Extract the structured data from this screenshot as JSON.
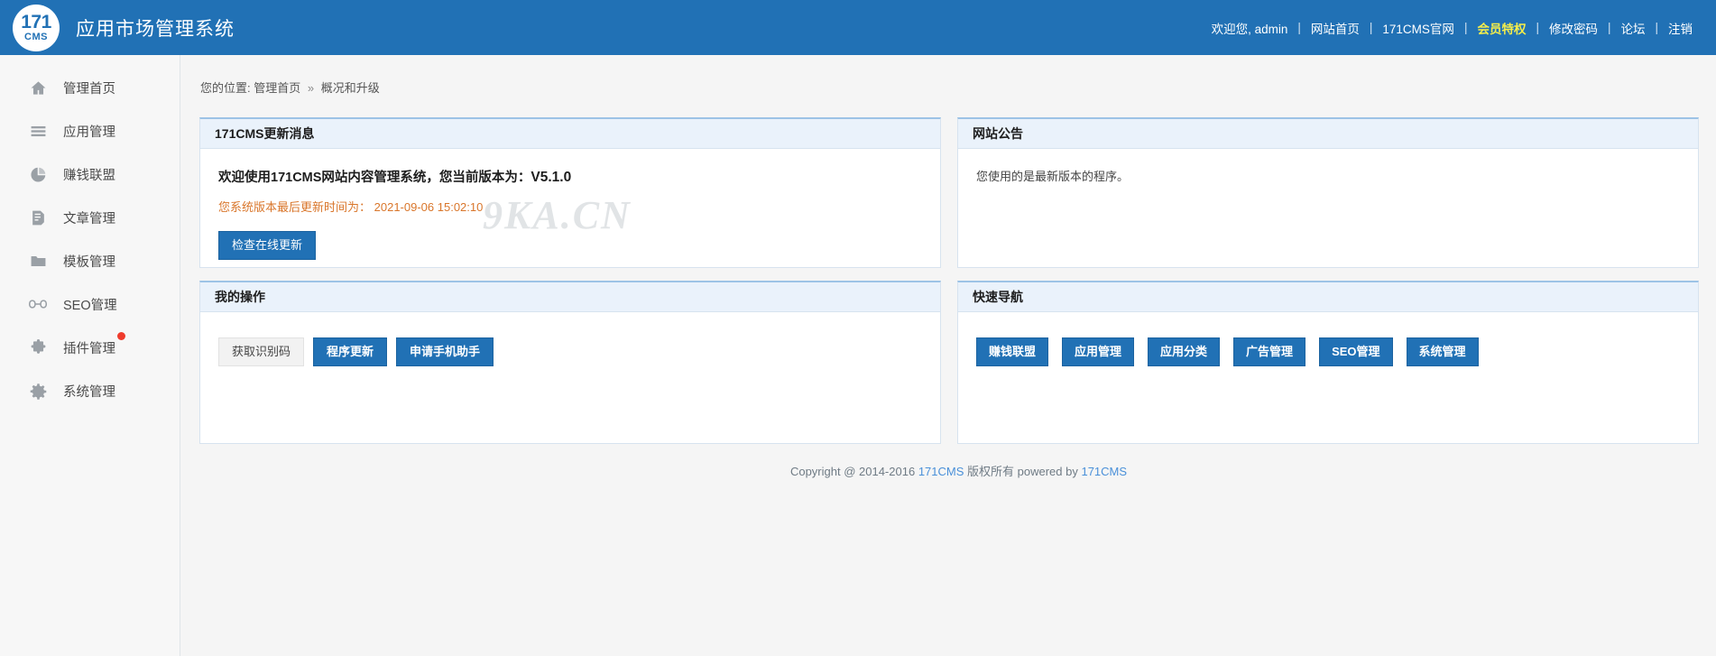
{
  "header": {
    "logo_top": "171",
    "logo_bottom": "CMS",
    "title": "应用市场管理系统",
    "brand_color": "#2171b5",
    "nav": {
      "welcome": "欢迎您, admin",
      "items": [
        {
          "label": "网站首页",
          "highlight": false
        },
        {
          "label": "171CMS官网",
          "highlight": false
        },
        {
          "label": "会员特权",
          "highlight": true
        },
        {
          "label": "修改密码",
          "highlight": false
        },
        {
          "label": "论坛",
          "highlight": false
        },
        {
          "label": "注销",
          "highlight": false
        }
      ],
      "highlight_color": "#f5ee4a"
    }
  },
  "sidebar": {
    "items": [
      {
        "label": "管理首页",
        "icon": "home-icon",
        "badge": false
      },
      {
        "label": "应用管理",
        "icon": "list-icon",
        "badge": false
      },
      {
        "label": "赚钱联盟",
        "icon": "pie-chart-icon",
        "badge": false
      },
      {
        "label": "文章管理",
        "icon": "document-icon",
        "badge": false
      },
      {
        "label": "模板管理",
        "icon": "folder-icon",
        "badge": false
      },
      {
        "label": "SEO管理",
        "icon": "link-icon",
        "badge": false
      },
      {
        "label": "插件管理",
        "icon": "puzzle-icon",
        "badge": true
      },
      {
        "label": "系统管理",
        "icon": "gear-icon",
        "badge": false
      }
    ],
    "badge_color": "#ef3b2c"
  },
  "breadcrumb": {
    "prefix": "您的位置:",
    "root": "管理首页",
    "separator": "»",
    "current": "概况和升级"
  },
  "watermark": "9KA.CN",
  "panels": {
    "update_news": {
      "title": "171CMS更新消息",
      "welcome_text": "欢迎使用171CMS网站内容管理系统，您当前版本为：",
      "version": "V5.1.0",
      "last_update_label": "您系统版本最后更新时间为：",
      "last_update_time": "2021-09-06 15:02:10",
      "check_update_button": "检查在线更新",
      "notice_color": "#d9762b"
    },
    "site_announcement": {
      "title": "网站公告",
      "body": "您使用的是最新版本的程序。"
    },
    "my_operations": {
      "title": "我的操作",
      "buttons": [
        {
          "label": "获取识别码",
          "style": "plain"
        },
        {
          "label": "程序更新",
          "style": "primary"
        },
        {
          "label": "申请手机助手",
          "style": "primary"
        }
      ]
    },
    "quick_nav": {
      "title": "快速导航",
      "buttons": [
        {
          "label": "赚钱联盟"
        },
        {
          "label": "应用管理"
        },
        {
          "label": "应用分类"
        },
        {
          "label": "广告管理"
        },
        {
          "label": "SEO管理"
        },
        {
          "label": "系统管理"
        }
      ]
    }
  },
  "footer": {
    "copyright_prefix": "Copyright @ 2014-2016",
    "brand1": "171CMS",
    "middle": "版权所有 powered by",
    "brand2": "171CMS",
    "link_color": "#4a90d9"
  }
}
